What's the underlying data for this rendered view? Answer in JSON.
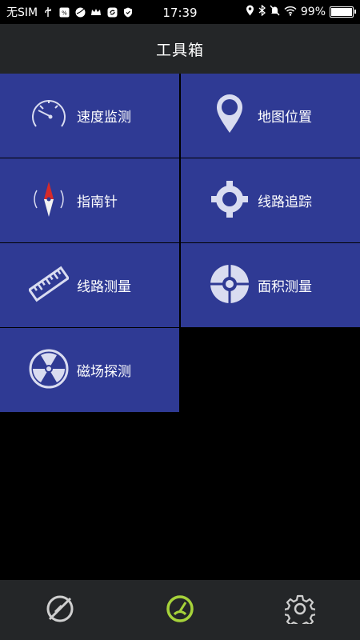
{
  "status_bar": {
    "carrier": "无SIM",
    "time": "17:39",
    "battery_text": "99%",
    "battery_level": 0.99
  },
  "header": {
    "title": "工具箱"
  },
  "tools": [
    {
      "label": "速度监测",
      "icon": "speedometer-icon"
    },
    {
      "label": "地图位置",
      "icon": "map-pin-icon"
    },
    {
      "label": "指南针",
      "icon": "compass-icon"
    },
    {
      "label": "线路追踪",
      "icon": "crosshair-icon"
    },
    {
      "label": "线路测量",
      "icon": "ruler-icon"
    },
    {
      "label": "面积测量",
      "icon": "target-icon"
    },
    {
      "label": "磁场探测",
      "icon": "radiation-icon"
    }
  ],
  "bottom_nav": [
    {
      "icon": "no-tracking-icon",
      "active": false
    },
    {
      "icon": "gauge-icon",
      "active": true,
      "color": "#a6d23a"
    },
    {
      "icon": "settings-gear-icon",
      "active": false
    }
  ],
  "colors": {
    "tile": "#2f3a94",
    "header": "#242628",
    "icon": "#d9dcf0",
    "accent": "#a6d23a"
  }
}
